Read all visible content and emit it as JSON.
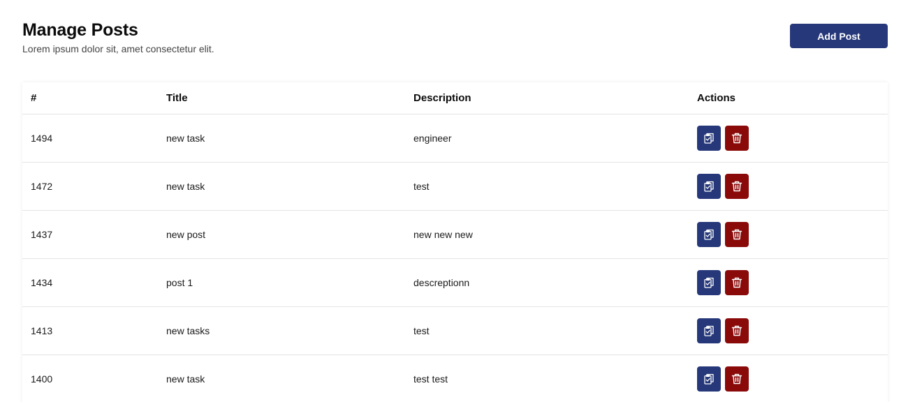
{
  "header": {
    "title": "Manage Posts",
    "subtitle": "Lorem ipsum dolor sit, amet consectetur elit.",
    "add_button_label": "Add Post"
  },
  "table": {
    "columns": [
      "#",
      "Title",
      "Description",
      "Actions"
    ],
    "rows": [
      {
        "id": "1494",
        "title": "new task",
        "description": "engineer"
      },
      {
        "id": "1472",
        "title": "new task",
        "description": "test"
      },
      {
        "id": "1437",
        "title": "new post",
        "description": "new new new"
      },
      {
        "id": "1434",
        "title": "post 1",
        "description": "descreptionn"
      },
      {
        "id": "1413",
        "title": "new tasks",
        "description": "test"
      },
      {
        "id": "1400",
        "title": "new task",
        "description": "test test"
      }
    ],
    "action_icons": [
      "clipboard-copy-icon",
      "trash-icon"
    ]
  },
  "colors": {
    "primary": "#26387a",
    "danger": "#8a0a0a",
    "text": "#111111",
    "divider": "#e4e4e4"
  }
}
